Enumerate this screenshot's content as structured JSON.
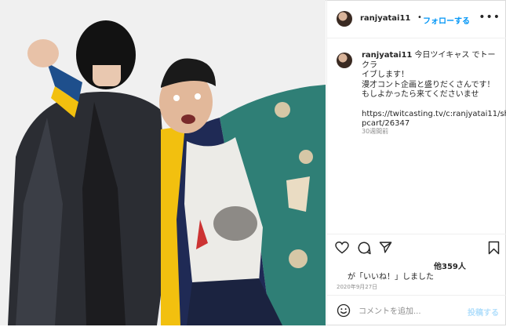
{
  "post": {
    "username": "ranjyatai11",
    "follow_label": "フォローする",
    "dot": "•",
    "more_label": "•••",
    "caption_lines": [
      "今日ツイキャス でトークラ",
      "イブします！",
      "漫才コント企画と盛りだくさんです！",
      "もしよかったら来てくださいませ"
    ],
    "link_lines": [
      "https://twitcasting.tv/c:ranjyatai11/sho",
      "pcart/26347"
    ],
    "time_ago": "30週間前",
    "likes_count": "他359人",
    "likes_suffix": "が「いいね！」しました",
    "date": "2020年9月27日",
    "comment_placeholder": "コメントを追加...",
    "post_label": "投稿する"
  },
  "icons": {
    "more": "more-options-icon",
    "like": "heart-icon",
    "comment": "comment-icon",
    "share": "share-icon",
    "save": "bookmark-icon",
    "emoji": "emoji-icon"
  },
  "colors": {
    "link": "#0095f6",
    "muted": "#8e8e8e",
    "post_disabled": "#b2dffc",
    "border": "#dbdbdb"
  }
}
